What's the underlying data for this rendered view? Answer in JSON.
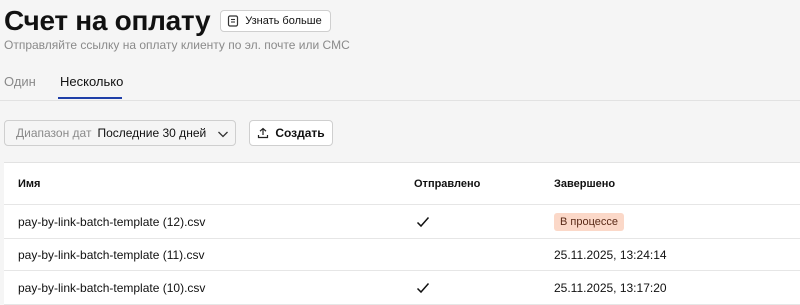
{
  "header": {
    "title": "Счет на оплату",
    "learn_more_label": "Узнать больше",
    "subtitle": "Отправляйте ссылку на оплату клиенту по эл. почте или СМС"
  },
  "tabs": [
    {
      "label": "Один",
      "active": false
    },
    {
      "label": "Несколько",
      "active": true
    }
  ],
  "filters": {
    "date_range_label": "Диапазон дат",
    "date_range_value": "Последние 30 дней",
    "create_label": "Создать"
  },
  "table": {
    "columns": [
      "Имя",
      "Отправлено",
      "Завершено"
    ],
    "rows": [
      {
        "name": "pay-by-link-batch-template (12).csv",
        "sent": true,
        "completed": "В процессе",
        "completed_is_status": true
      },
      {
        "name": "pay-by-link-batch-template (11).csv",
        "sent": false,
        "completed": "25.11.2025, 13:24:14",
        "completed_is_status": false
      },
      {
        "name": "pay-by-link-batch-template (10).csv",
        "sent": true,
        "completed": "25.11.2025, 13:17:20",
        "completed_is_status": false
      }
    ]
  },
  "colors": {
    "accent": "#1f3fa8",
    "status_in_progress_bg": "#fbd8c8"
  },
  "icons": {
    "learn_more": "document-icon",
    "date_dropdown": "chevron-down-icon",
    "create": "upload-icon",
    "sent": "checkmark-icon"
  }
}
